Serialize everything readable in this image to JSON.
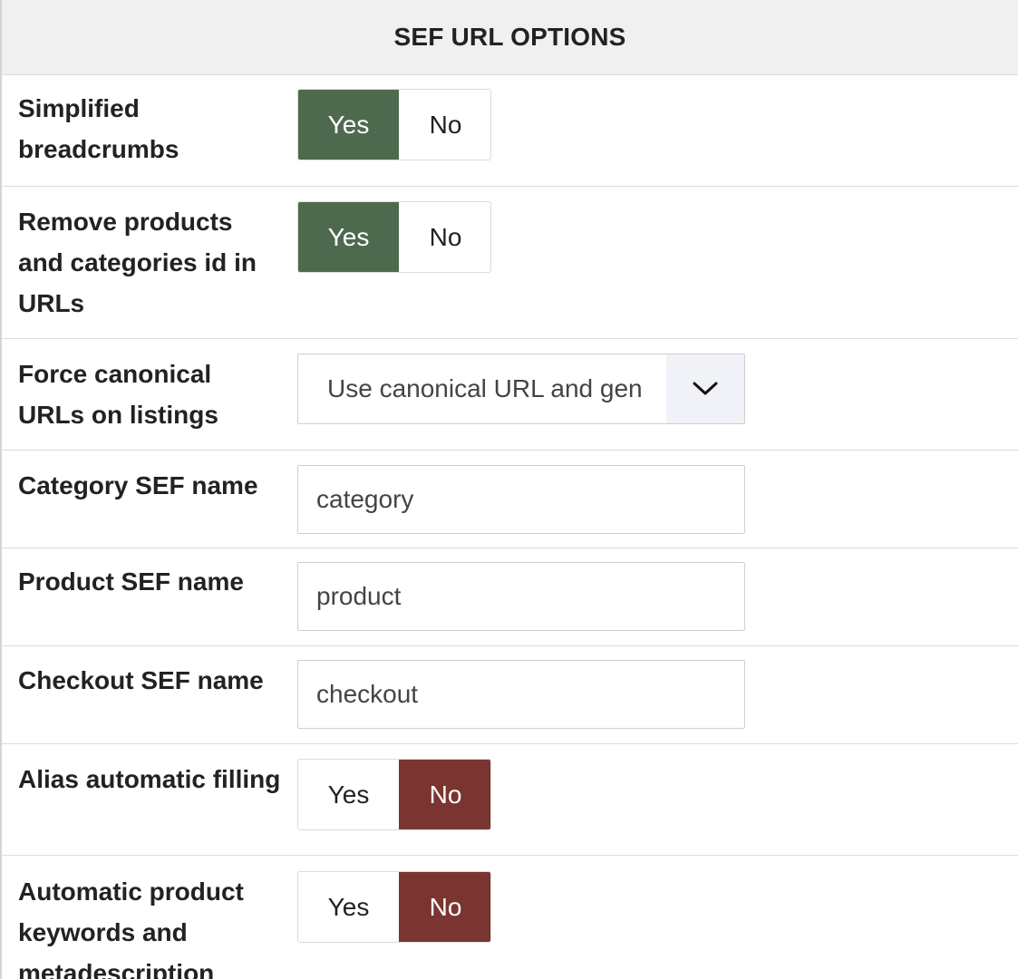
{
  "panel": {
    "title": "SEF URL OPTIONS"
  },
  "options": {
    "simplified_breadcrumbs": {
      "label": "Simplified breadcrumbs",
      "yes": "Yes",
      "no": "No",
      "selected": "Yes"
    },
    "remove_ids": {
      "label": "Remove products and categories id in URLs",
      "yes": "Yes",
      "no": "No",
      "selected": "Yes"
    },
    "force_canonical": {
      "label": "Force canonical URLs on listings",
      "value": "Use canonical URL and gen"
    },
    "category_sef": {
      "label": "Category SEF name",
      "value": "category"
    },
    "product_sef": {
      "label": "Product SEF name",
      "value": "product"
    },
    "checkout_sef": {
      "label": "Checkout SEF name",
      "value": "checkout"
    },
    "alias_filling": {
      "label": "Alias automatic filling",
      "yes": "Yes",
      "no": "No",
      "selected": "No"
    },
    "auto_keywords": {
      "label": "Automatic product keywords and metadescription",
      "yes": "Yes",
      "no": "No",
      "selected": "No"
    }
  },
  "colors": {
    "yes_active": "#4e6a4e",
    "no_active": "#7a3530",
    "header_bg": "#f0f0f0"
  },
  "icons": {
    "select_arrow": "chevron-down-icon"
  }
}
